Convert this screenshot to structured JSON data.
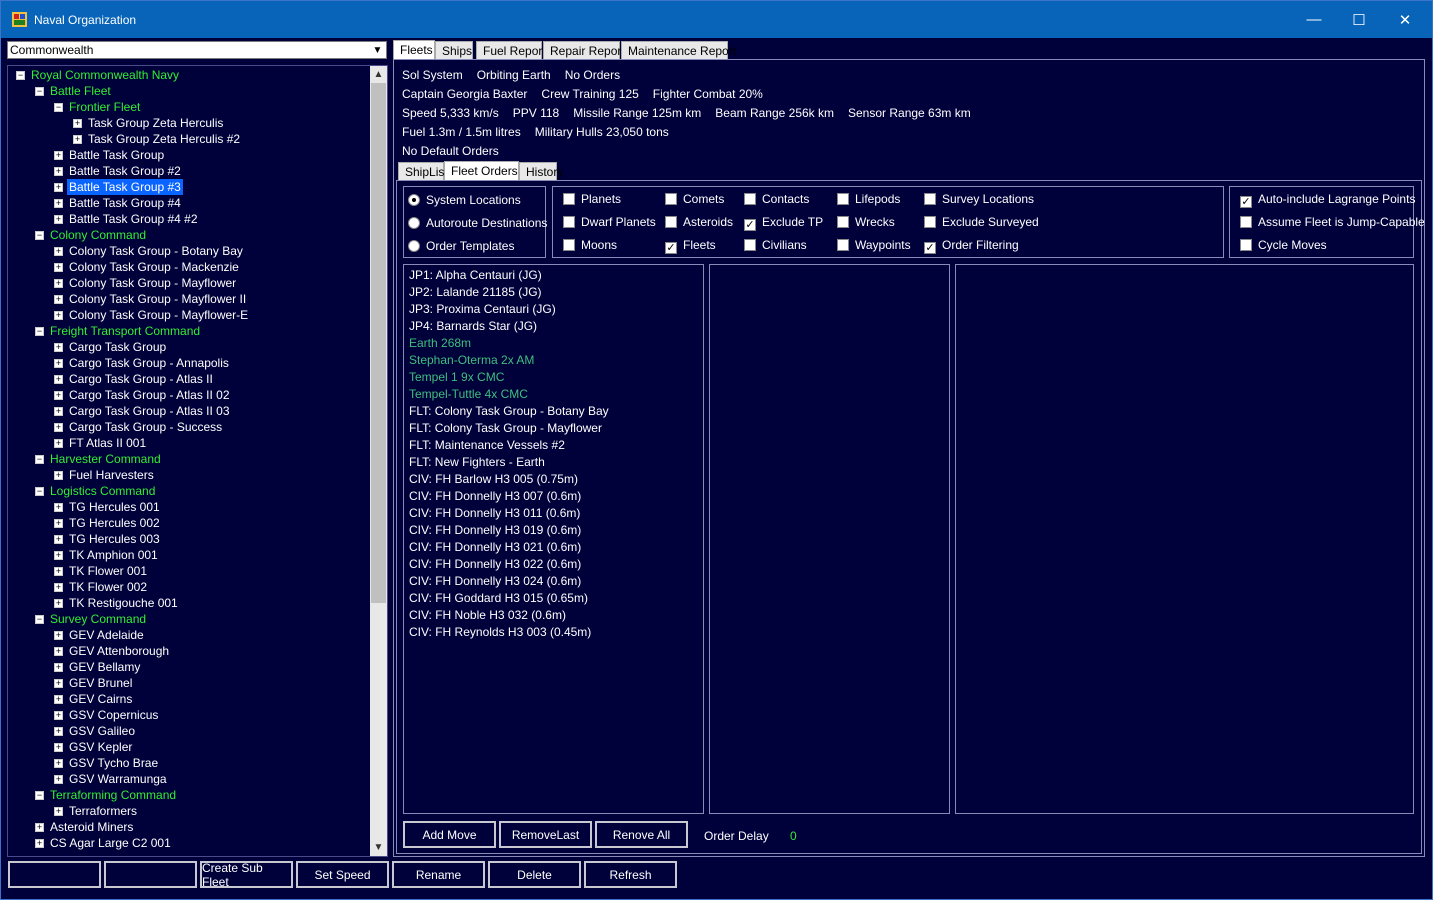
{
  "window": {
    "title": "Naval Organization",
    "controls": {
      "minimize": "—",
      "maximize": "☐",
      "close": "✕"
    }
  },
  "empire_select": {
    "value": "Commonwealth"
  },
  "tree": [
    {
      "label": "Royal Commonwealth Navy",
      "level": 0,
      "expanded": true,
      "green": true
    },
    {
      "label": "Battle Fleet",
      "level": 1,
      "expanded": true,
      "green": true
    },
    {
      "label": "Frontier Fleet",
      "level": 2,
      "expanded": true,
      "green": true
    },
    {
      "label": "Task Group Zeta Herculis",
      "level": 3,
      "expanded": false,
      "green": false
    },
    {
      "label": "Task Group Zeta Herculis #2",
      "level": 3,
      "expanded": false,
      "green": false
    },
    {
      "label": "Battle Task Group",
      "level": 2,
      "expanded": false,
      "green": false
    },
    {
      "label": "Battle Task Group #2",
      "level": 2,
      "expanded": false,
      "green": false
    },
    {
      "label": "Battle Task Group #3",
      "level": 2,
      "expanded": false,
      "green": false,
      "selected": true
    },
    {
      "label": "Battle Task Group #4",
      "level": 2,
      "expanded": false,
      "green": false
    },
    {
      "label": "Battle Task Group #4 #2",
      "level": 2,
      "expanded": false,
      "green": false
    },
    {
      "label": "Colony Command",
      "level": 1,
      "expanded": true,
      "green": true
    },
    {
      "label": "Colony Task Group - Botany Bay",
      "level": 2,
      "expanded": false,
      "green": false
    },
    {
      "label": "Colony Task Group - Mackenzie",
      "level": 2,
      "expanded": false,
      "green": false
    },
    {
      "label": "Colony Task Group - Mayflower",
      "level": 2,
      "expanded": false,
      "green": false
    },
    {
      "label": "Colony Task Group - Mayflower II",
      "level": 2,
      "expanded": false,
      "green": false
    },
    {
      "label": "Colony Task Group - Mayflower-E",
      "level": 2,
      "expanded": false,
      "green": false
    },
    {
      "label": "Freight Transport Command",
      "level": 1,
      "expanded": true,
      "green": true
    },
    {
      "label": "Cargo Task Group",
      "level": 2,
      "expanded": false,
      "green": false
    },
    {
      "label": "Cargo Task Group - Annapolis",
      "level": 2,
      "expanded": false,
      "green": false
    },
    {
      "label": "Cargo Task Group - Atlas II",
      "level": 2,
      "expanded": false,
      "green": false
    },
    {
      "label": "Cargo Task Group - Atlas II 02",
      "level": 2,
      "expanded": false,
      "green": false
    },
    {
      "label": "Cargo Task Group - Atlas II 03",
      "level": 2,
      "expanded": false,
      "green": false
    },
    {
      "label": "Cargo Task Group - Success",
      "level": 2,
      "expanded": false,
      "green": false
    },
    {
      "label": "FT Atlas II 001",
      "level": 2,
      "expanded": false,
      "green": false
    },
    {
      "label": "Harvester Command",
      "level": 1,
      "expanded": true,
      "green": true
    },
    {
      "label": "Fuel Harvesters",
      "level": 2,
      "expanded": false,
      "green": false
    },
    {
      "label": "Logistics Command",
      "level": 1,
      "expanded": true,
      "green": true
    },
    {
      "label": "TG Hercules 001",
      "level": 2,
      "expanded": false,
      "green": false
    },
    {
      "label": "TG Hercules 002",
      "level": 2,
      "expanded": false,
      "green": false
    },
    {
      "label": "TG Hercules 003",
      "level": 2,
      "expanded": false,
      "green": false
    },
    {
      "label": "TK Amphion 001",
      "level": 2,
      "expanded": false,
      "green": false
    },
    {
      "label": "TK Flower 001",
      "level": 2,
      "expanded": false,
      "green": false
    },
    {
      "label": "TK Flower 002",
      "level": 2,
      "expanded": false,
      "green": false
    },
    {
      "label": "TK Restigouche 001",
      "level": 2,
      "expanded": false,
      "green": false
    },
    {
      "label": "Survey Command",
      "level": 1,
      "expanded": true,
      "green": true
    },
    {
      "label": "GEV Adelaide",
      "level": 2,
      "expanded": false,
      "green": false
    },
    {
      "label": "GEV Attenborough",
      "level": 2,
      "expanded": false,
      "green": false
    },
    {
      "label": "GEV Bellamy",
      "level": 2,
      "expanded": false,
      "green": false
    },
    {
      "label": "GEV Brunel",
      "level": 2,
      "expanded": false,
      "green": false
    },
    {
      "label": "GEV Cairns",
      "level": 2,
      "expanded": false,
      "green": false
    },
    {
      "label": "GSV Copernicus",
      "level": 2,
      "expanded": false,
      "green": false
    },
    {
      "label": "GSV Galileo",
      "level": 2,
      "expanded": false,
      "green": false
    },
    {
      "label": "GSV Kepler",
      "level": 2,
      "expanded": false,
      "green": false
    },
    {
      "label": "GSV Tycho Brae",
      "level": 2,
      "expanded": false,
      "green": false
    },
    {
      "label": "GSV Warramunga",
      "level": 2,
      "expanded": false,
      "green": false
    },
    {
      "label": "Terraforming Command",
      "level": 1,
      "expanded": true,
      "green": true
    },
    {
      "label": "Terraformers",
      "level": 2,
      "expanded": false,
      "green": false
    },
    {
      "label": "Asteroid Miners",
      "level": 1,
      "expanded": false,
      "green": false
    },
    {
      "label": "CS Agar Large C2 001",
      "level": 1,
      "expanded": false,
      "green": false
    }
  ],
  "tabs": [
    "Fleets",
    "Ships",
    "Fuel Report",
    "Repair Report",
    "Maintenance Report"
  ],
  "fleet_info": {
    "line1": [
      "Sol System",
      "Orbiting Earth",
      "No Orders"
    ],
    "line2": [
      "Captain Georgia Baxter",
      "Crew Training 125",
      "Fighter Combat 20%"
    ],
    "line3": [
      "Speed 5,333 km/s",
      "PPV 118",
      "Missile Range 125m  km",
      "Beam Range 256k  km",
      "Sensor Range 63m  km"
    ],
    "line4": [
      "Fuel 1.3m / 1.5m litres",
      "Military Hulls 23,050 tons"
    ],
    "line5": [
      "No Default Orders"
    ]
  },
  "sub_tabs": [
    "ShipList",
    "Fleet Orders",
    "History"
  ],
  "radio_options": [
    {
      "label": "System Locations",
      "checked": true
    },
    {
      "label": "Autoroute Destinations",
      "checked": false
    },
    {
      "label": "Order Templates",
      "checked": false
    }
  ],
  "filter_checks": [
    {
      "label": "Planets",
      "checked": false
    },
    {
      "label": "Comets",
      "checked": false
    },
    {
      "label": "Contacts",
      "checked": false
    },
    {
      "label": "Lifepods",
      "checked": false
    },
    {
      "label": "Survey Locations",
      "checked": false
    },
    {
      "label": "Dwarf Planets",
      "checked": false
    },
    {
      "label": "Asteroids",
      "checked": false
    },
    {
      "label": "Exclude TP",
      "checked": true
    },
    {
      "label": "Wrecks",
      "checked": false
    },
    {
      "label": "Exclude Surveyed",
      "checked": false
    },
    {
      "label": "Moons",
      "checked": false
    },
    {
      "label": "Fleets",
      "checked": true
    },
    {
      "label": "Civilians",
      "checked": false
    },
    {
      "label": "Waypoints",
      "checked": false
    },
    {
      "label": "Order Filtering",
      "checked": true
    }
  ],
  "move_checks": [
    {
      "label": "Auto-include Lagrange Points",
      "checked": true
    },
    {
      "label": "Assume Fleet is Jump-Capable",
      "checked": false
    },
    {
      "label": "Cycle Moves",
      "checked": false
    }
  ],
  "locations": [
    {
      "label": "JP1: Alpha Centauri  (JG)",
      "green": false
    },
    {
      "label": "JP2: Lalande 21185 (JG)",
      "green": false
    },
    {
      "label": "JP3: Proxima Centauri  (JG)",
      "green": false
    },
    {
      "label": "JP4: Barnards Star (JG)",
      "green": false
    },
    {
      "label": "Earth  268m",
      "green": true
    },
    {
      "label": "Stephan-Oterma  2x AM",
      "green": true
    },
    {
      "label": "Tempel 1  9x CMC",
      "green": true
    },
    {
      "label": "Tempel-Tuttle  4x CMC",
      "green": true
    },
    {
      "label": "FLT: Colony Task Group - Botany Bay",
      "green": false
    },
    {
      "label": "FLT: Colony Task Group - Mayflower",
      "green": false
    },
    {
      "label": "FLT: Maintenance Vessels #2",
      "green": false
    },
    {
      "label": "FLT: New Fighters - Earth",
      "green": false
    },
    {
      "label": "CIV: FH Barlow H3 005  (0.75m)",
      "green": false
    },
    {
      "label": "CIV: FH Donnelly H3 007  (0.6m)",
      "green": false
    },
    {
      "label": "CIV: FH Donnelly H3 011  (0.6m)",
      "green": false
    },
    {
      "label": "CIV: FH Donnelly H3 019  (0.6m)",
      "green": false
    },
    {
      "label": "CIV: FH Donnelly H3 021  (0.6m)",
      "green": false
    },
    {
      "label": "CIV: FH Donnelly H3 022  (0.6m)",
      "green": false
    },
    {
      "label": "CIV: FH Donnelly H3 024  (0.6m)",
      "green": false
    },
    {
      "label": "CIV: FH Goddard H3 015  (0.65m)",
      "green": false
    },
    {
      "label": "CIV: FH Noble H3 032  (0.6m)",
      "green": false
    },
    {
      "label": "CIV: FH Reynolds H3 003  (0.45m)",
      "green": false
    }
  ],
  "order_buttons": {
    "add": "Add Move",
    "remove_last": "RemoveLast",
    "remove_all": "Renove All"
  },
  "order_delay": {
    "label": "Order Delay",
    "value": "0"
  },
  "bottom_buttons": [
    "Create Sub Fleet",
    "Set Speed",
    "Rename",
    "Delete",
    "Refresh"
  ],
  "colors": {
    "background": "#00003a",
    "accent_green": "#33ee33",
    "selection": "#0a64ff",
    "titlebar": "#0764b8"
  }
}
